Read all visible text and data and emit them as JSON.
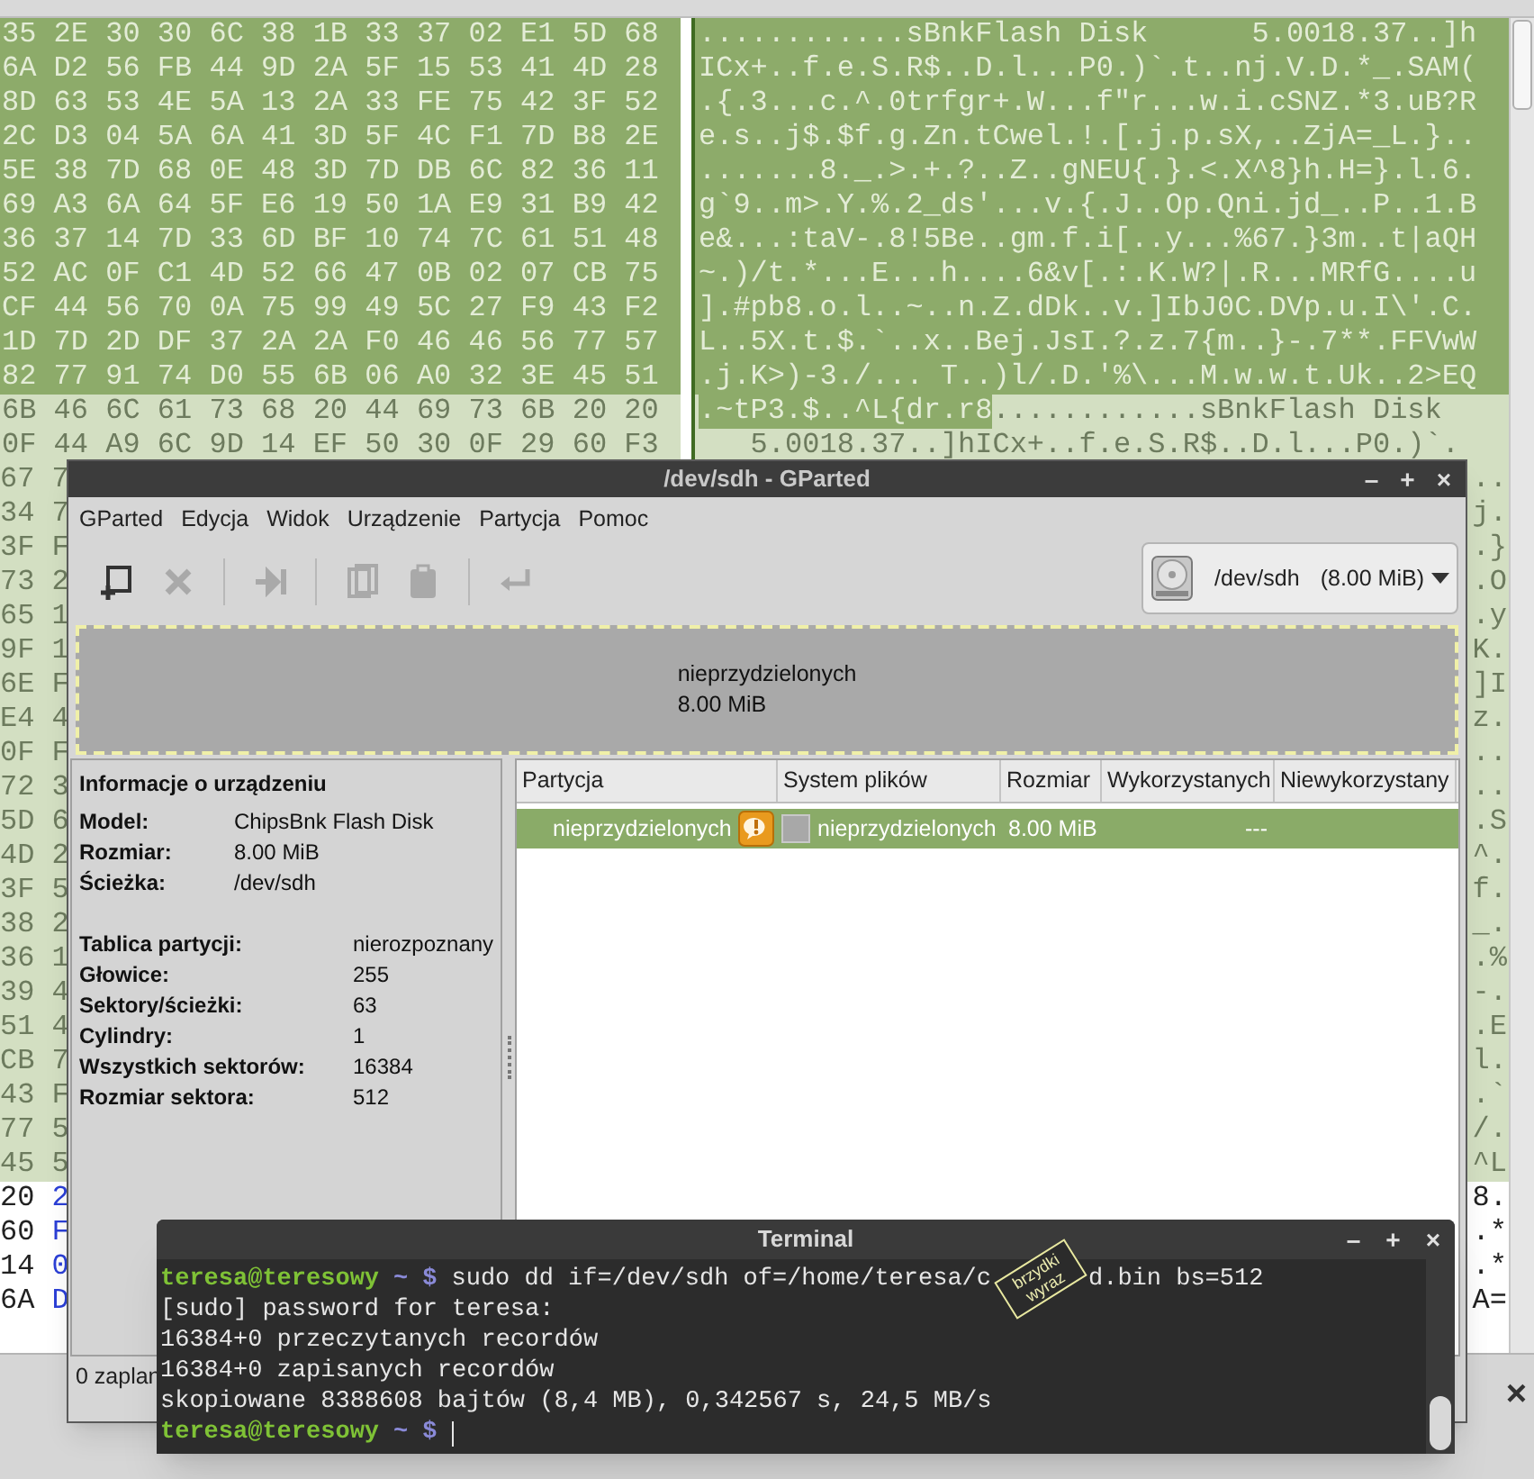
{
  "hex_editor": {
    "rows": [
      {
        "hex": {
          "text": "35 2E 30 30 6C 38 1B 33 37 02 E1 5D 68",
          "kind": "selected"
        },
        "ascii": [
          {
            "text": "............sBnkFlash Disk      5.0018.37..]h",
            "kind": "selected"
          }
        ]
      },
      {
        "hex": {
          "text": "6A D2 56 FB 44 9D 2A 5F 15 53 41 4D 28",
          "kind": "selected"
        },
        "ascii": [
          {
            "text": "ICx+..f.e.S.R$..D.l...P0.)`.t..nj.V.D.*_.SAM(",
            "kind": "selected"
          }
        ]
      },
      {
        "hex": {
          "text": "8D 63 53 4E 5A 13 2A 33 FE 75 42 3F 52",
          "kind": "selected"
        },
        "ascii": [
          {
            "text": ".{.3...c.^.0trfgr+.W...f\"r...w.i.cSNZ.*3.uB?R",
            "kind": "selected"
          }
        ]
      },
      {
        "hex": {
          "text": "2C D3 04 5A 6A 41 3D 5F 4C F1 7D B8 2E",
          "kind": "selected"
        },
        "ascii": [
          {
            "text": "e.s..j$.$f.g.Zn.tCwel.!.[.j.p.sX,..ZjA=_L.}..",
            "kind": "selected"
          }
        ]
      },
      {
        "hex": {
          "text": "5E 38 7D 68 0E 48 3D 7D DB 6C 82 36 11",
          "kind": "selected"
        },
        "ascii": [
          {
            "text": ".......8._.>.+.?..Z..gNEU{.}.<.X^8}h.H=}.l.6.",
            "kind": "selected"
          }
        ]
      },
      {
        "hex": {
          "text": "69 A3 6A 64 5F E6 19 50 1A E9 31 B9 42",
          "kind": "selected"
        },
        "ascii": [
          {
            "text": "g`9..m>.Y.%.2_ds'...v.{.J..Op.Qni.jd_..P..1.B",
            "kind": "selected"
          }
        ]
      },
      {
        "hex": {
          "text": "36 37 14 7D 33 6D BF 10 74 7C 61 51 48",
          "kind": "selected"
        },
        "ascii": [
          {
            "text": "e&...:taV-.8!5Be..gm.f.i[..y...%67.}3m..t|aQH",
            "kind": "selected"
          }
        ]
      },
      {
        "hex": {
          "text": "52 AC 0F C1 4D 52 66 47 0B 02 07 CB 75",
          "kind": "selected"
        },
        "ascii": [
          {
            "text": "~.)/t.*...E...h....6&v[.:.K.W?|.R...MRfG....u",
            "kind": "selected"
          }
        ]
      },
      {
        "hex": {
          "text": "CF 44 56 70 0A 75 99 49 5C 27 F9 43 F2",
          "kind": "selected"
        },
        "ascii": [
          {
            "text": "].#pb8.o.l..~..n.Z.dDk..v.]IbJ0C.DVp.u.I\\'.C.",
            "kind": "selected"
          }
        ]
      },
      {
        "hex": {
          "text": "1D 7D 2D DF 37 2A 2A F0 46 46 56 77 57",
          "kind": "selected"
        },
        "ascii": [
          {
            "text": "L..5X.t.$.`..x..Bej.JsI.?.z.7{m..}-.7**.FFVwW",
            "kind": "selected"
          }
        ]
      },
      {
        "hex": {
          "text": "82 77 91 74 D0 55 6B 06 A0 32 3E 45 51",
          "kind": "selected"
        },
        "ascii": [
          {
            "text": ".j.K>)-3./... T..)l/.D.'%\\...M.w.w.t.Uk..2>EQ",
            "kind": "selected"
          }
        ]
      },
      {
        "hex": {
          "text": "6B 46 6C 61 73 68 20 44 69 73 6B 20 20",
          "kind": "match"
        },
        "ascii": [
          {
            "text": ".~tP3.$..^L{dr.r8",
            "kind": "selected"
          },
          {
            "text": "............sBnkFlash Disk",
            "kind": "match"
          }
        ]
      },
      {
        "hex": {
          "text": "0F 44 A9 6C 9D 14 EF 50 30 0F 29 60 F3",
          "kind": "match"
        },
        "ascii": [
          {
            "text": "   5.0018.37..]hICx+..f.e.S.R$..D.l...P0.)`.",
            "kind": "match"
          }
        ]
      }
    ],
    "edge_rows": [
      {
        "left": [
          {
            "text": "67 7",
            "kind": "match"
          }
        ],
        "right": [
          {
            "text": "..",
            "kind": "match"
          }
        ]
      },
      {
        "left": [
          {
            "text": "34 7",
            "kind": "match"
          }
        ],
        "right": [
          {
            "text": "j.",
            "kind": "match"
          }
        ]
      },
      {
        "left": [
          {
            "text": "3F F",
            "kind": "match"
          }
        ],
        "right": [
          {
            "text": ".}",
            "kind": "match"
          }
        ]
      },
      {
        "left": [
          {
            "text": "73 2",
            "kind": "match"
          }
        ],
        "right": [
          {
            "text": ".O",
            "kind": "match"
          }
        ]
      },
      {
        "left": [
          {
            "text": "65 1",
            "kind": "match"
          }
        ],
        "right": [
          {
            "text": ".y",
            "kind": "match"
          }
        ]
      },
      {
        "left": [
          {
            "text": "9F 1",
            "kind": "match"
          }
        ],
        "right": [
          {
            "text": "K.",
            "kind": "match"
          }
        ]
      },
      {
        "left": [
          {
            "text": "6E F",
            "kind": "match"
          }
        ],
        "right": [
          {
            "text": "]I",
            "kind": "match"
          }
        ]
      },
      {
        "left": [
          {
            "text": "E4 4",
            "kind": "match"
          }
        ],
        "right": [
          {
            "text": "z.",
            "kind": "match"
          }
        ]
      },
      {
        "left": [
          {
            "text": "0F F",
            "kind": "match"
          }
        ],
        "right": [
          {
            "text": "..",
            "kind": "match"
          }
        ]
      },
      {
        "left": [
          {
            "text": "72 3",
            "kind": "match"
          }
        ],
        "right": [
          {
            "text": "..",
            "kind": "match"
          }
        ]
      },
      {
        "left": [
          {
            "text": "5D 6",
            "kind": "match"
          }
        ],
        "right": [
          {
            "text": ".S",
            "kind": "match"
          }
        ]
      },
      {
        "left": [
          {
            "text": "4D 2",
            "kind": "match"
          }
        ],
        "right": [
          {
            "text": "^.",
            "kind": "match"
          }
        ]
      },
      {
        "left": [
          {
            "text": "3F 5",
            "kind": "match"
          }
        ],
        "right": [
          {
            "text": "f.",
            "kind": "match"
          }
        ]
      },
      {
        "left": [
          {
            "text": "38 2",
            "kind": "match"
          }
        ],
        "right": [
          {
            "text": "_.",
            "kind": "match"
          }
        ]
      },
      {
        "left": [
          {
            "text": "36 1",
            "kind": "match"
          }
        ],
        "right": [
          {
            "text": ".%",
            "kind": "match"
          }
        ]
      },
      {
        "left": [
          {
            "text": "39 4",
            "kind": "match"
          }
        ],
        "right": [
          {
            "text": "-.",
            "kind": "match"
          }
        ]
      },
      {
        "left": [
          {
            "text": "51 4",
            "kind": "match"
          }
        ],
        "right": [
          {
            "text": ".E",
            "kind": "match"
          }
        ]
      },
      {
        "left": [
          {
            "text": "CB 7",
            "kind": "match"
          }
        ],
        "right": [
          {
            "text": "l.",
            "kind": "match"
          }
        ]
      },
      {
        "left": [
          {
            "text": "43 F",
            "kind": "match"
          }
        ],
        "right": [
          {
            "text": ".`",
            "kind": "match"
          }
        ]
      },
      {
        "left": [
          {
            "text": "77 5",
            "kind": "match"
          }
        ],
        "right": [
          {
            "text": "/.",
            "kind": "match"
          }
        ]
      },
      {
        "left": [
          {
            "text": "45 5",
            "kind": "match"
          }
        ],
        "right": [
          {
            "text": "^L",
            "kind": "match"
          }
        ]
      },
      {
        "left": [
          {
            "text": "20",
            "kind": "plain"
          },
          {
            "text": "2",
            "kind": "offset"
          }
        ],
        "right": [
          {
            "text": "8.",
            "kind": "plain"
          }
        ]
      },
      {
        "left": [
          {
            "text": "60",
            "kind": "plain"
          },
          {
            "text": "F",
            "kind": "offset"
          }
        ],
        "right": [
          {
            "text": ".*",
            "kind": "plain"
          }
        ]
      },
      {
        "left": [
          {
            "text": "14",
            "kind": "plain"
          },
          {
            "text": "0",
            "kind": "offset"
          }
        ],
        "right": [
          {
            "text": ".*",
            "kind": "plain"
          }
        ]
      },
      {
        "left": [
          {
            "text": "6A",
            "kind": "plain"
          },
          {
            "text": "D",
            "kind": "offset"
          }
        ],
        "right": [
          {
            "text": "A=",
            "kind": "plain"
          }
        ]
      }
    ],
    "close_label": "×"
  },
  "gparted": {
    "title": "/dev/sdh - GParted",
    "controls": [
      "–",
      "+",
      "×"
    ],
    "menu": [
      "GParted",
      "Edycja",
      "Widok",
      "Urządzenie",
      "Partycja",
      "Pomoc"
    ],
    "toolbar": [
      {
        "kind": "new",
        "disabled": false
      },
      {
        "kind": "delete",
        "disabled": true
      },
      {
        "kind": "separator"
      },
      {
        "kind": "resize",
        "disabled": true
      },
      {
        "kind": "separator"
      },
      {
        "kind": "copy",
        "disabled": true
      },
      {
        "kind": "paste",
        "disabled": true
      },
      {
        "kind": "separator"
      },
      {
        "kind": "undo",
        "disabled": true
      }
    ],
    "device": {
      "name": "/dev/sdh",
      "size": "(8.00 MiB)"
    },
    "disk_map": {
      "label": "nieprzydzielonych",
      "size": "8.00 MiB"
    },
    "info": {
      "heading": "Informacje o urządzeniu",
      "groups": [
        [
          {
            "label": "Model:",
            "value": "ChipsBnk Flash Disk"
          },
          {
            "label": "Rozmiar:",
            "value": "8.00 MiB"
          },
          {
            "label": "Ścieżka:",
            "value": "/dev/sdh"
          }
        ],
        [
          {
            "label": "Tablica partycji:",
            "value": "nierozpoznany"
          },
          {
            "label": "Głowice:",
            "value": "255"
          },
          {
            "label": "Sektory/ścieżki:",
            "value": "63"
          },
          {
            "label": "Cylindry:",
            "value": "1"
          },
          {
            "label": "Wszystkich sektorów:",
            "value": "16384"
          },
          {
            "label": "Rozmiar sektora:",
            "value": "512"
          }
        ]
      ]
    },
    "table": {
      "columns": [
        "Partycja",
        "System plików",
        "Rozmiar",
        "Wykorzystanych",
        "Niewykorzystany"
      ],
      "rows": [
        {
          "selected": true,
          "partition": "nieprzydzielonych",
          "warning": true,
          "filesystem": "nieprzydzielonych",
          "size": "8.00 MiB",
          "used": "---"
        }
      ]
    },
    "status": "0 zaplan"
  },
  "terminal": {
    "title": "Terminal",
    "controls": [
      "–",
      "+",
      "×"
    ],
    "lines": [
      {
        "kind": "prompt",
        "user": "teresa@teresowy",
        "path": "~",
        "symbol": "$",
        "command": "sudo dd if=/dev/sdh of=/home/teresa/c",
        "command_after": "d.bin bs=512"
      },
      {
        "kind": "output",
        "text": "[sudo] password for teresa:"
      },
      {
        "kind": "output",
        "text": "16384+0 przeczytanych recordów"
      },
      {
        "kind": "output",
        "text": "16384+0 zapisanych recordów"
      },
      {
        "kind": "output",
        "text": "skopiowane 8388608 bajtów (8,4 MB), 0,342567 s, 24,5 MB/s"
      },
      {
        "kind": "prompt",
        "user": "teresa@teresowy",
        "path": "~",
        "symbol": "$",
        "cursor": true
      }
    ],
    "sticker": [
      "brzydki",
      "wyraz"
    ]
  }
}
